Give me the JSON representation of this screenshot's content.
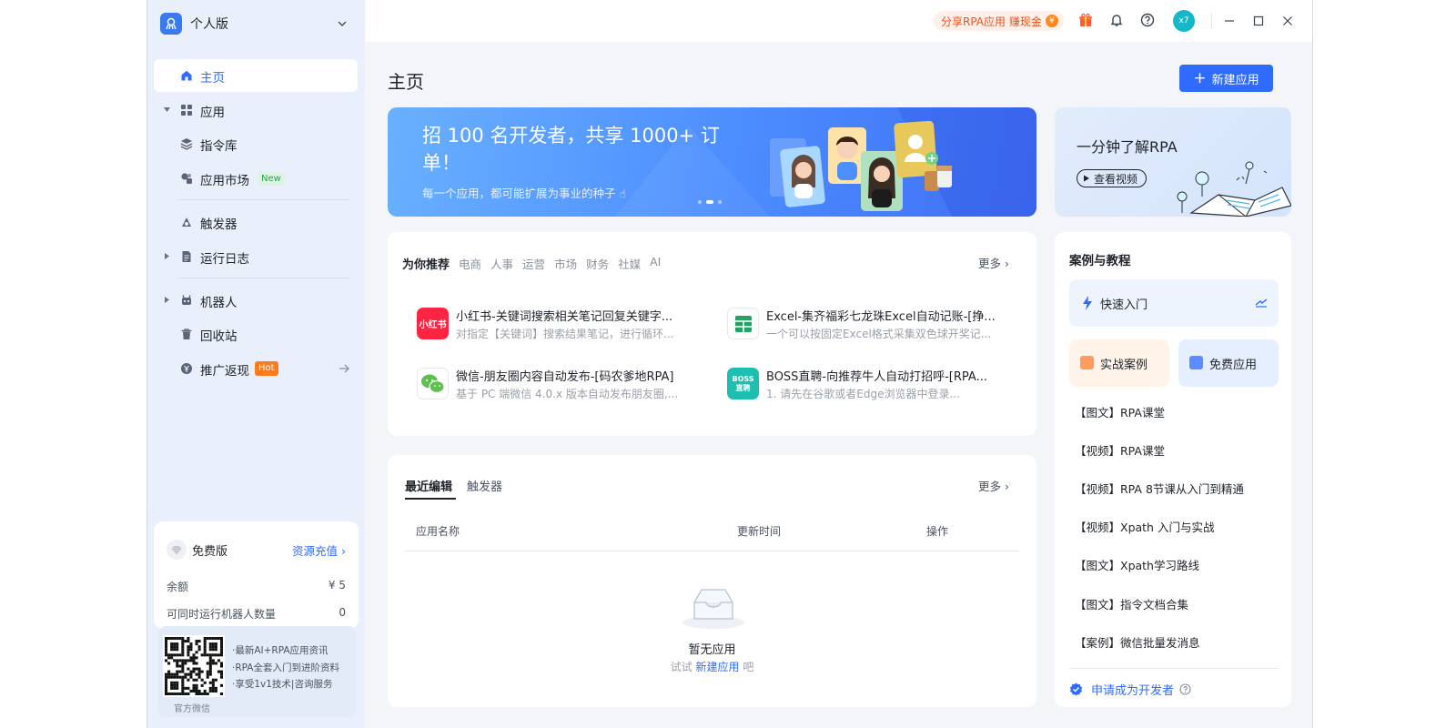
{
  "sidebar": {
    "edition": "个人版",
    "nav": {
      "home": "主页",
      "apps": "应用",
      "commands": "指令库",
      "market": "应用市场",
      "market_badge": "New",
      "triggers": "触发器",
      "logs": "运行日志",
      "robots": "机器人",
      "recycle": "回收站",
      "promo": "推广返现",
      "promo_badge": "Hot"
    },
    "plan": {
      "name": "免费版",
      "recharge": "资源充值 ›",
      "balance_label": "余额",
      "balance_value": "¥ 5",
      "robots_label": "可同时运行机器人数量",
      "robots_value": "0"
    },
    "wechat": {
      "lines": [
        "·最新AI+RPA应用资讯",
        "·RPA全套入门到进阶资料",
        "·享受1v1技术|咨询服务"
      ],
      "caption": "官方微信"
    }
  },
  "topbar": {
    "share": "分享RPA应用 赚现金",
    "coin": "¥",
    "avatar": "x7"
  },
  "main": {
    "title": "主页",
    "new_app": "新建应用",
    "banner": {
      "title": "招 100 名开发者，共享 1000+ 订单！",
      "subtitle": "每一个应用，都可能扩展为事业的种子 ☝"
    },
    "rpa_card": {
      "title": "一分钟了解RPA",
      "button": "查看视频"
    },
    "recommend": {
      "tabs": [
        "为你推荐",
        "电商",
        "人事",
        "运营",
        "市场",
        "财务",
        "社媒",
        "AI"
      ],
      "more": "更多 ›",
      "apps": [
        {
          "name": "小红书-关键词搜索相关笔记回复关键字...",
          "desc": "对指定【关键词】搜索结果笔记，进行循环...",
          "icon_text": "小红书",
          "icon": "xiaohongshu-icon",
          "color": "#ff2442"
        },
        {
          "name": "Excel-集齐福彩七龙珠Excel自动记账-[挣...",
          "desc": "一个可以按固定Excel格式采集双色球开奖记...",
          "icon_text": "",
          "icon": "excel-icon",
          "color": "#1fa463"
        },
        {
          "name": "微信-朋友圈内容自动发布-[码农爹地RPA]",
          "desc": "基于 PC 端微信 4.0.x 版本自动发布朋友圈,...",
          "icon_text": "",
          "icon": "wechat-icon",
          "color": "#5ec14d"
        },
        {
          "name": "BOSS直聘-向推荐牛人自动打招呼-[RPA...",
          "desc": "1.        请先在谷歌或者Edge浏览器中登录...",
          "icon_text": "BOSS直聘",
          "icon": "boss-icon",
          "color": "#1dbfb0"
        }
      ]
    },
    "recent": {
      "tabs": [
        "最近编辑",
        "触发器"
      ],
      "more": "更多 ›",
      "columns": [
        "应用名称",
        "更新时间",
        "操作"
      ],
      "empty_title": "暂无应用",
      "empty_prefix": "试试",
      "empty_link": "新建应用",
      "empty_suffix": "吧"
    },
    "cases": {
      "title": "案例与教程",
      "quick": "快速入门",
      "tile_cases": "实战案例",
      "tile_free": "免费应用",
      "items": [
        "【图文】RPA课堂",
        "【视频】RPA课堂",
        "【视频】RPA 8节课从入门到精通",
        "【视频】Xpath 入门与实战",
        "【图文】Xpath学习路线",
        "【图文】指令文档合集",
        "【案例】微信批量发消息"
      ],
      "apply": "申请成为开发者"
    }
  },
  "colors": {
    "accent": "#2f6bff",
    "sidebar_bg": "#e9f0fb",
    "hot": "#ff7a19"
  }
}
